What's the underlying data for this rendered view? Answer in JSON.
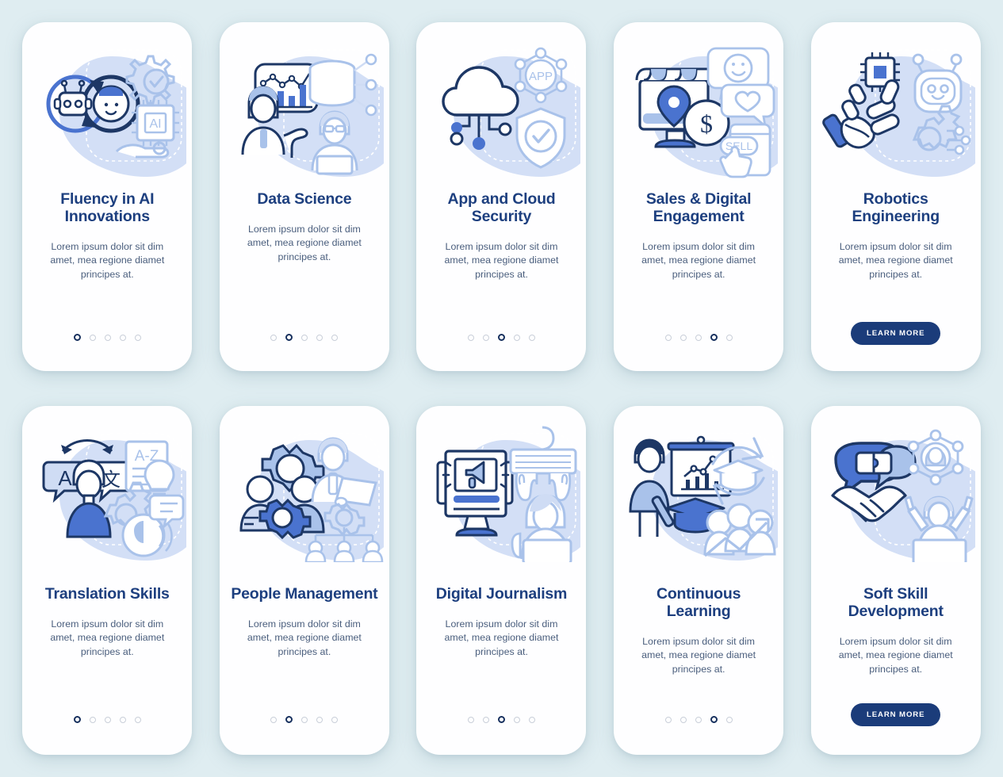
{
  "page": {
    "background_color": "#dfedf1",
    "card_background": "#fefeff",
    "title_color": "#1d3f7f",
    "body_color": "#4a5e7d",
    "accent_navy": "#1b3c7a",
    "accent_blue": "#4a73cf",
    "dot_inactive_color": "#c9cfd9",
    "dot_active_color": "#17305e"
  },
  "shared": {
    "body_text": "Lorem ipsum dolor sit dim amet, mea regione diamet principes at.",
    "learn_more_label": "LEARN MORE",
    "dot_count": 5
  },
  "cards": [
    {
      "id": "fluency-in-ai-innovations",
      "title": "Fluency in AI Innovations",
      "body": "Lorem ipsum dolor sit dim amet, mea regione diamet principes at.",
      "illustration": "robot-human-exchange-ai-chip-icon",
      "dots": 5,
      "active_dot": 1,
      "has_button": false,
      "button_label": ""
    },
    {
      "id": "data-science",
      "title": "Data Science",
      "body": "Lorem ipsum dolor sit dim amet, mea regione diamet principes at.",
      "illustration": "analyst-chart-database-icon",
      "dots": 5,
      "active_dot": 2,
      "has_button": false,
      "button_label": ""
    },
    {
      "id": "app-and-cloud-security",
      "title": "App and Cloud Security",
      "body": "Lorem ipsum dolor sit dim amet, mea regione diamet principes at.",
      "illustration": "cloud-network-app-shield-icon",
      "dots": 5,
      "active_dot": 3,
      "has_button": false,
      "button_label": ""
    },
    {
      "id": "sales-and-digital-engagement",
      "title": "Sales & Digital Engagement",
      "body": "Lorem ipsum dolor sit dim amet, mea regione diamet principes at.",
      "illustration": "storefront-dollar-sell-chat-icon",
      "dots": 5,
      "active_dot": 4,
      "has_button": false,
      "button_label": ""
    },
    {
      "id": "robotics-engineering",
      "title": "Robotics Engineering",
      "body": "Lorem ipsum dolor sit dim amet, mea regione diamet principes at.",
      "illustration": "robot-arm-chip-bot-gear-icon",
      "dots": 0,
      "active_dot": 0,
      "has_button": true,
      "button_label": "LEARN MORE"
    },
    {
      "id": "translation-skills",
      "title": "Translation Skills",
      "body": "Lorem ipsum dolor sit dim amet, mea regione diamet principes at.",
      "illustration": "language-bubbles-person-az-icon",
      "dots": 5,
      "active_dot": 1,
      "has_button": false,
      "button_label": ""
    },
    {
      "id": "people-management",
      "title": "People Management",
      "body": "Lorem ipsum dolor sit dim amet, mea regione diamet principes at.",
      "illustration": "team-gears-org-chart-icon",
      "dots": 5,
      "active_dot": 2,
      "has_button": false,
      "button_label": ""
    },
    {
      "id": "digital-journalism",
      "title": "Digital Journalism",
      "body": "Lorem ipsum dolor sit dim amet, mea regione diamet principes at.",
      "illustration": "monitor-megaphone-keyboard-writer-icon",
      "dots": 5,
      "active_dot": 3,
      "has_button": false,
      "button_label": ""
    },
    {
      "id": "continuous-learning",
      "title": "Continuous Learning",
      "body": "Lorem ipsum dolor sit dim amet, mea regione diamet principes at.",
      "illustration": "presenter-graduation-cap-growth-icon",
      "dots": 5,
      "active_dot": 4,
      "has_button": false,
      "button_label": ""
    },
    {
      "id": "soft-skill-development",
      "title": "Soft Skill Development",
      "body": "Lorem ipsum dolor sit dim amet, mea regione diamet principes at.",
      "illustration": "handshake-network-team-icon",
      "dots": 0,
      "active_dot": 0,
      "has_button": true,
      "button_label": "LEARN MORE"
    }
  ]
}
